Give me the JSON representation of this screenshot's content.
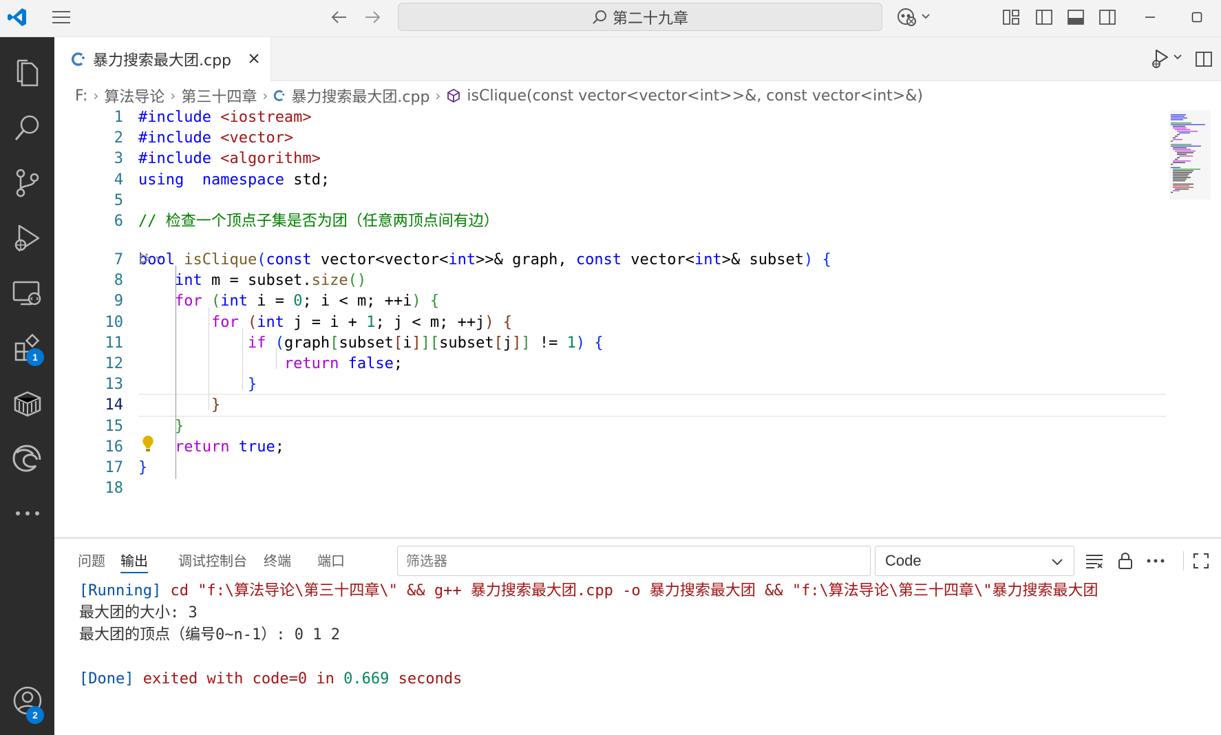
{
  "titlebar": {
    "search_text": "第二十九章"
  },
  "tab": {
    "label": "暴力搜索最大团.cpp"
  },
  "breadcrumb": {
    "items": [
      "F:",
      "算法导论",
      "第三十四章",
      "暴力搜索最大团.cpp",
      "isClique(const vector<vector<int>>&, const vector<int>&)"
    ]
  },
  "activitybar": {
    "extensions_badge": "1",
    "accounts_badge": "2"
  },
  "editor": {
    "active_line": 14,
    "line_numbers": [
      "1",
      "2",
      "3",
      "4",
      "5",
      "6",
      "7",
      "8",
      "9",
      "10",
      "11",
      "12",
      "13",
      "14",
      "15",
      "16",
      "17",
      "18"
    ],
    "lines": [
      {
        "t": [
          [
            "inc",
            "#include "
          ],
          [
            "str",
            "<iostream>"
          ]
        ]
      },
      {
        "t": [
          [
            "inc",
            "#include "
          ],
          [
            "str",
            "<vector>"
          ]
        ]
      },
      {
        "t": [
          [
            "inc",
            "#include "
          ],
          [
            "str",
            "<algorithm>"
          ]
        ]
      },
      {
        "t": [
          [
            "kw",
            "using"
          ],
          [
            "",
            "  "
          ],
          [
            "kw",
            "namespace"
          ],
          [
            "",
            " std;"
          ]
        ]
      },
      {
        "t": []
      },
      {
        "t": [
          [
            "cm",
            "// 检查一个顶点子集是否为团（任意两顶点间有边）"
          ]
        ]
      },
      {
        "t": [
          [
            "ty",
            "bool"
          ],
          [
            "",
            " "
          ],
          [
            "fn",
            "isClique"
          ],
          [
            "p1",
            "("
          ],
          [
            "kw",
            "const"
          ],
          [
            "",
            " vector<vector<"
          ],
          [
            "ty",
            "int"
          ],
          [
            "",
            ">>& graph, "
          ],
          [
            "kw",
            "const"
          ],
          [
            "",
            " vector<"
          ],
          [
            "ty",
            "int"
          ],
          [
            "",
            ">& subset"
          ],
          [
            "p1",
            ")"
          ],
          [
            "",
            " "
          ],
          [
            "p1",
            "{"
          ]
        ]
      },
      {
        "t": [
          [
            "",
            "    "
          ],
          [
            "ty",
            "int"
          ],
          [
            "",
            " m = subset."
          ],
          [
            "fn",
            "size"
          ],
          [
            "p2",
            "()"
          ],
          [
            ";"
          ]
        ]
      },
      {
        "t": [
          [
            "",
            "    "
          ],
          [
            "ctl",
            "for"
          ],
          [
            "",
            " "
          ],
          [
            "p2",
            "("
          ],
          [
            "ty",
            "int"
          ],
          [
            "",
            " i = "
          ],
          [
            "num",
            "0"
          ],
          [
            "",
            "; i < m; ++i"
          ],
          [
            "p2",
            ")"
          ],
          [
            "",
            " "
          ],
          [
            "p2",
            "{"
          ]
        ]
      },
      {
        "t": [
          [
            "",
            "        "
          ],
          [
            "ctl",
            "for"
          ],
          [
            "",
            " "
          ],
          [
            "p3",
            "("
          ],
          [
            "ty",
            "int"
          ],
          [
            "",
            " j = i + "
          ],
          [
            "num",
            "1"
          ],
          [
            "",
            "; j < m; ++j"
          ],
          [
            "p3",
            ")"
          ],
          [
            "",
            " "
          ],
          [
            "p3",
            "{"
          ]
        ]
      },
      {
        "t": [
          [
            "",
            "            "
          ],
          [
            "ctl",
            "if"
          ],
          [
            "",
            " "
          ],
          [
            "p1",
            "("
          ],
          [
            "",
            "graph"
          ],
          [
            "p2",
            "["
          ],
          [
            "",
            "subset"
          ],
          [
            "p3",
            "["
          ],
          [
            "",
            "i"
          ],
          [
            "p3",
            "]"
          ],
          [
            "p2",
            "]"
          ],
          [
            "p2",
            "["
          ],
          [
            "",
            "subset"
          ],
          [
            "p3",
            "["
          ],
          [
            "",
            "j"
          ],
          [
            "p3",
            "]"
          ],
          [
            "p2",
            "]"
          ],
          [
            "",
            " != "
          ],
          [
            "num",
            "1"
          ],
          [
            "p1",
            ")"
          ],
          [
            "",
            " "
          ],
          [
            "p1",
            "{"
          ]
        ]
      },
      {
        "t": [
          [
            "",
            "                "
          ],
          [
            "ctl",
            "return"
          ],
          [
            "",
            " "
          ],
          [
            "kw",
            "false"
          ],
          [
            "",
            ";"
          ]
        ]
      },
      {
        "t": [
          [
            "",
            "            "
          ],
          [
            "p1",
            "}"
          ]
        ]
      },
      {
        "t": [
          [
            "",
            "        "
          ],
          [
            "p3",
            "}"
          ]
        ]
      },
      {
        "t": [
          [
            "",
            "    "
          ],
          [
            "p2",
            "}"
          ]
        ]
      },
      {
        "t": [
          [
            "",
            "    "
          ],
          [
            "ctl",
            "return"
          ],
          [
            "",
            " "
          ],
          [
            "kw",
            "true"
          ],
          [
            "",
            ";"
          ]
        ]
      },
      {
        "t": [
          [
            "p1",
            "}"
          ]
        ]
      },
      {
        "t": []
      }
    ]
  },
  "panel": {
    "tabs": [
      "问题",
      "输出",
      "调试控制台",
      "终端",
      "端口"
    ],
    "active_tab": "输出",
    "filter_placeholder": "筛选器",
    "channel": "Code",
    "output": {
      "line1_tag": "[Running]",
      "line1_cmd": " cd \"f:\\算法导论\\第三十四章\\\" && g++ 暴力搜索最大团.cpp -o 暴力搜索最大团 && \"f:\\算法导论\\第三十四章\\\"暴力搜索最大团",
      "line2": "最大团的大小: 3",
      "line3": "最大团的顶点（编号0~n-1）: 0 1 2",
      "done_tag": "[Done]",
      "done_text": " exited with ",
      "done_code": "code=0",
      "done_in": " in ",
      "done_time": "0.669",
      "done_seconds": " seconds"
    }
  },
  "colors": {
    "accent": "#0078d4",
    "activitybar_bg": "#2c2c2c",
    "titlebar_bg": "#f3f3f3"
  }
}
